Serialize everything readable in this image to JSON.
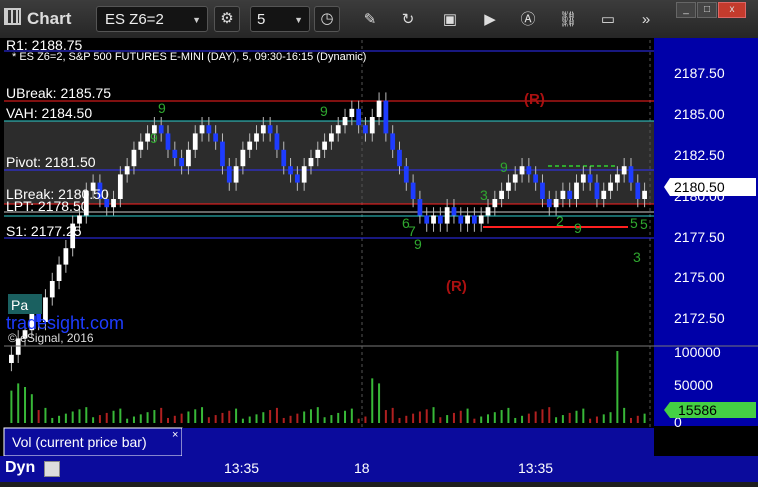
{
  "toolbar": {
    "app_title": "Chart",
    "symbol": "ES Z6=2",
    "interval": "5",
    "window_buttons": [
      "_",
      "□",
      "x"
    ]
  },
  "chart": {
    "subtitle": "* ES Z6=2, S&P 500 FUTURES E-MINI (DAY), 5, 09:30-16:15 (Dynamic)",
    "top_label_fragment": "R1: 2188.75",
    "current_price": "2180.50",
    "watermark": "tradesight.com",
    "copyright": "© eSignal, 2016",
    "price_axis": [
      "2187.50",
      "2185.00",
      "2182.50",
      "2180.00",
      "2177.50",
      "2175.00",
      "2172.50"
    ],
    "levels": [
      {
        "label": "UBreak: 2185.75"
      },
      {
        "label": "VAH: 2184.50"
      },
      {
        "label": "Pivot: 2181.50"
      },
      {
        "label": "LBreak: 2180.50"
      },
      {
        "label": "LPT: 2178.50"
      },
      {
        "label": "S1: 2177.25"
      }
    ],
    "r_markers": [
      "(R)",
      "(R)"
    ],
    "counts": [
      "9",
      "9",
      "9",
      "9",
      "9",
      "9",
      "3",
      "5",
      "7",
      "6",
      "2",
      "5",
      "3"
    ],
    "box_label": "Pa"
  },
  "volume": {
    "axis": [
      "100000",
      "50000",
      "0"
    ],
    "current_volume": "15586",
    "legend": "Vol (current price bar)",
    "legend_close": "×"
  },
  "time_axis": {
    "labels": [
      "13:35",
      "18",
      "13:35"
    ],
    "dyn": "Dyn"
  },
  "colors": {
    "bull": "#ffffff",
    "bear": "#1e3cff",
    "red_line": "#ff2020",
    "blue_line": "#3030ff",
    "green_text": "#2fa82f",
    "vol_green": "#38b838",
    "vol_red": "#b02020"
  }
}
